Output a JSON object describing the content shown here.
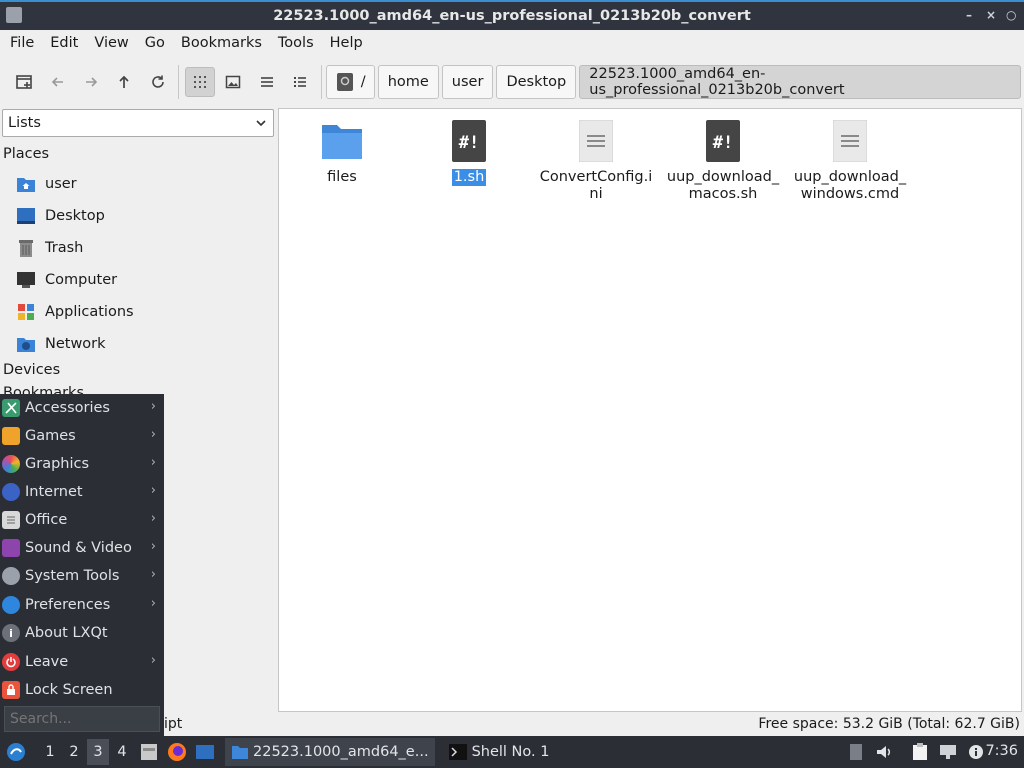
{
  "window": {
    "title": "22523.1000_amd64_en-us_professional_0213b20b_convert",
    "controls": [
      "–",
      "×",
      "○"
    ]
  },
  "menubar": [
    "File",
    "Edit",
    "View",
    "Go",
    "Bookmarks",
    "Tools",
    "Help"
  ],
  "breadcrumb": {
    "root": "/",
    "parts": [
      "home",
      "user",
      "Desktop"
    ],
    "current": "22523.1000_amd64_en-us_professional_0213b20b_convert"
  },
  "sidepane": {
    "mode": "Lists",
    "places_header": "Places",
    "places": [
      {
        "label": "user",
        "icon": "home-folder-icon"
      },
      {
        "label": "Desktop",
        "icon": "desktop-icon"
      },
      {
        "label": "Trash",
        "icon": "trash-icon"
      },
      {
        "label": "Computer",
        "icon": "computer-icon"
      },
      {
        "label": "Applications",
        "icon": "applications-icon"
      },
      {
        "label": "Network",
        "icon": "network-icon"
      }
    ],
    "devices_header": "Devices",
    "bookmarks_header": "Bookmarks"
  },
  "files": [
    {
      "name": "files",
      "icon": "folder-icon",
      "selected": false
    },
    {
      "name": "1.sh",
      "icon": "script-icon",
      "selected": true
    },
    {
      "name": "ConvertConfig.ini",
      "icon": "text-file-icon",
      "selected": false
    },
    {
      "name": "uup_download_macos.sh",
      "icon": "script-icon",
      "selected": false
    },
    {
      "name": "uup_download_windows.cmd",
      "icon": "text-file-icon",
      "selected": false
    }
  ],
  "statusbar": {
    "free": "Free space: 53.2 GiB (Total: 62.7 GiB)",
    "left_snippet": "ipt"
  },
  "appmenu": {
    "items": [
      {
        "label": "Accessories",
        "submenu": true
      },
      {
        "label": "Games",
        "submenu": true
      },
      {
        "label": "Graphics",
        "submenu": true
      },
      {
        "label": "Internet",
        "submenu": true
      },
      {
        "label": "Office",
        "submenu": true
      },
      {
        "label": "Sound & Video",
        "submenu": true
      },
      {
        "label": "System Tools",
        "submenu": true
      },
      {
        "label": "Preferences",
        "submenu": true
      },
      {
        "label": "About LXQt",
        "submenu": false
      },
      {
        "label": "Leave",
        "submenu": true
      },
      {
        "label": "Lock Screen",
        "submenu": false
      }
    ],
    "search_placeholder": "Search..."
  },
  "panel": {
    "workspaces": [
      "1",
      "2",
      "3",
      "4"
    ],
    "active_workspace": "3",
    "tasks": [
      {
        "label": "22523.1000_amd64_e...",
        "icon": "file-manager-icon"
      },
      {
        "label": "Shell No. 1",
        "icon": "terminal-icon"
      }
    ],
    "clock": "7:36"
  },
  "colors": {
    "titlebar": "#2f343f",
    "accent": "#3a8ee6",
    "menu_bg": "#2b2f35"
  }
}
